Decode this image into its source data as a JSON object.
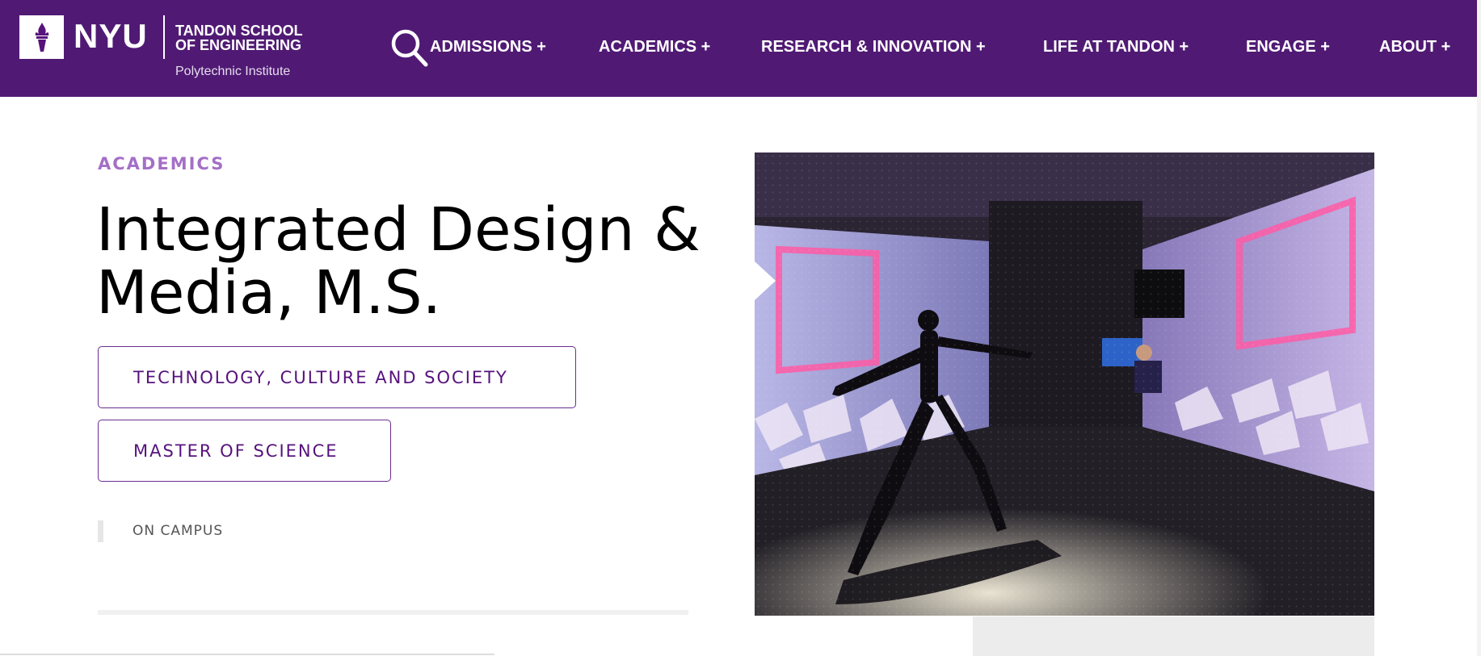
{
  "header": {
    "logo": {
      "wordmark": "NYU",
      "school": "TANDON SCHOOL OF ENGINEERING",
      "subtitle": "Polytechnic Institute",
      "icon": "torch-icon"
    },
    "search": {
      "icon": "search-icon"
    },
    "nav": [
      {
        "label": "ADMISSIONS +"
      },
      {
        "label": "ACADEMICS +"
      },
      {
        "label": "RESEARCH & INNOVATION +"
      },
      {
        "label": "LIFE AT TANDON +"
      },
      {
        "label": "ENGAGE +"
      },
      {
        "label": "ABOUT +"
      }
    ],
    "colors": {
      "brand": "#501a74"
    }
  },
  "main": {
    "eyebrow": "ACADEMICS",
    "title": "Integrated Design & Media, M.S.",
    "tags": [
      {
        "label": "TECHNOLOGY, CULTURE AND SOCIETY"
      },
      {
        "label": "MASTER OF SCIENCE"
      }
    ],
    "location": "ON CAMPUS",
    "colors": {
      "eyebrow": "#a46fc7",
      "tag_text": "#57127c",
      "tag_border": "#6a2d92"
    }
  },
  "hero": {
    "image": "motion-capture-dancer-photo"
  }
}
